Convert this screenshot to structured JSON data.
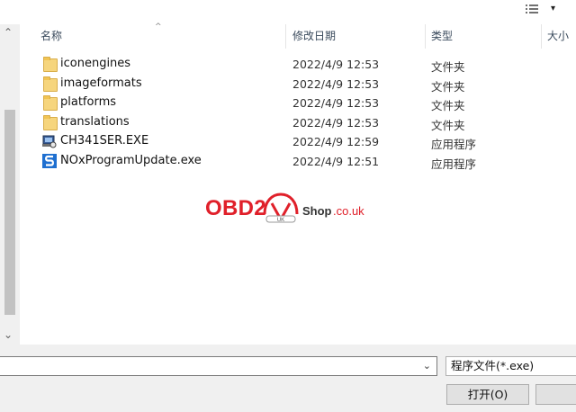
{
  "header": {
    "view_icon": "view-options-icon",
    "view_arrow": "▾",
    "columns": [
      "名称",
      "修改日期",
      "类型",
      "大小"
    ]
  },
  "files": [
    {
      "name": "iconengines",
      "date": "2022/4/9 12:53",
      "type": "文件夹",
      "icon": "folder-icon"
    },
    {
      "name": "imageformats",
      "date": "2022/4/9 12:53",
      "type": "文件夹",
      "icon": "folder-icon"
    },
    {
      "name": "platforms",
      "date": "2022/4/9 12:53",
      "type": "文件夹",
      "icon": "folder-icon"
    },
    {
      "name": "translations",
      "date": "2022/4/9 12:53",
      "type": "文件夹",
      "icon": "folder-icon"
    },
    {
      "name": "CH341SER.EXE",
      "date": "2022/4/9 12:59",
      "type": "应用程序",
      "icon": "installer-icon"
    },
    {
      "name": "NOxProgramUpdate.exe",
      "date": "2022/4/9 12:51",
      "type": "应用程序",
      "icon": "app-s-icon"
    }
  ],
  "watermark": {
    "brand": "OBD2",
    "car_text": "UK",
    "shop": "Shop",
    "domain": ".co.uk"
  },
  "footer": {
    "filename_value": "",
    "file_type_filter": "程序文件(*.exe)",
    "open_label": "打开(O)",
    "cancel_label": ""
  },
  "colors": {
    "watermark_red": "#e0202a",
    "folder_yellow": "#f6d57d",
    "app_blue": "#1e6fd0"
  }
}
